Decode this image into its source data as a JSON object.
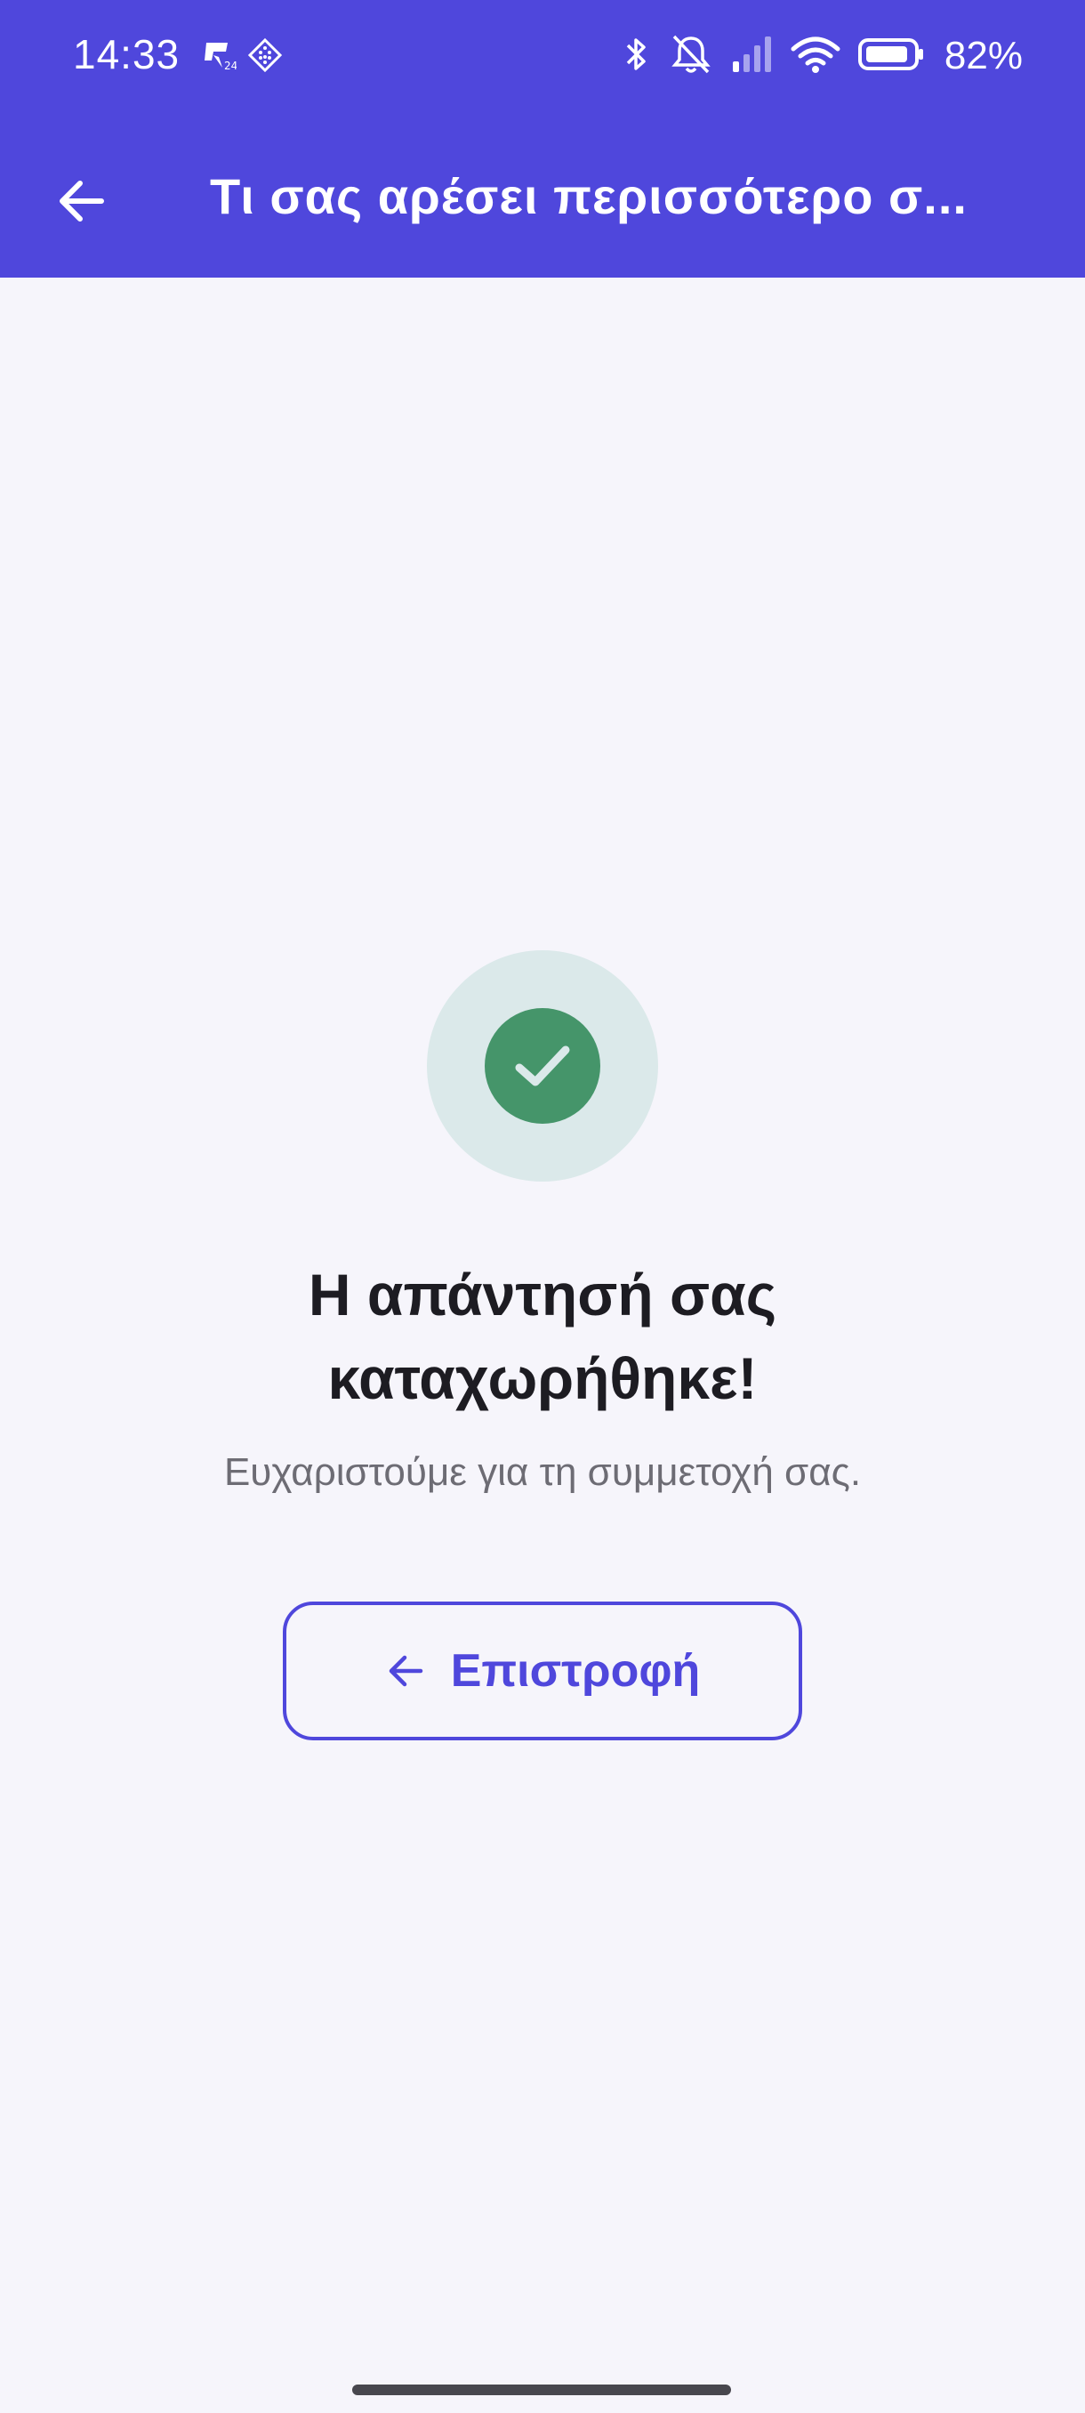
{
  "status_bar": {
    "time": "14:33",
    "battery_percent": "82%",
    "icons": [
      "notification-app-icon",
      "notification-grid-icon",
      "bluetooth-icon",
      "mute-icon",
      "signal-icon",
      "wifi-icon",
      "battery-icon"
    ]
  },
  "app_bar": {
    "title": "Τι σας αρέσει περισσότερο σ...",
    "back_icon": "arrow-left-icon"
  },
  "result": {
    "icon": "check-circle-icon",
    "headline": "Η απάντησή σας καταχωρήθηκε!",
    "subtext": "Ευχαριστούμε για τη συμμετοχή σας."
  },
  "actions": {
    "return_label": "Επιστροφή",
    "return_icon": "arrow-left-icon"
  },
  "colors": {
    "primary": "#4f47dc",
    "success": "#45956a",
    "success_bg": "#dbe9ea",
    "background": "#f6f5fb"
  }
}
